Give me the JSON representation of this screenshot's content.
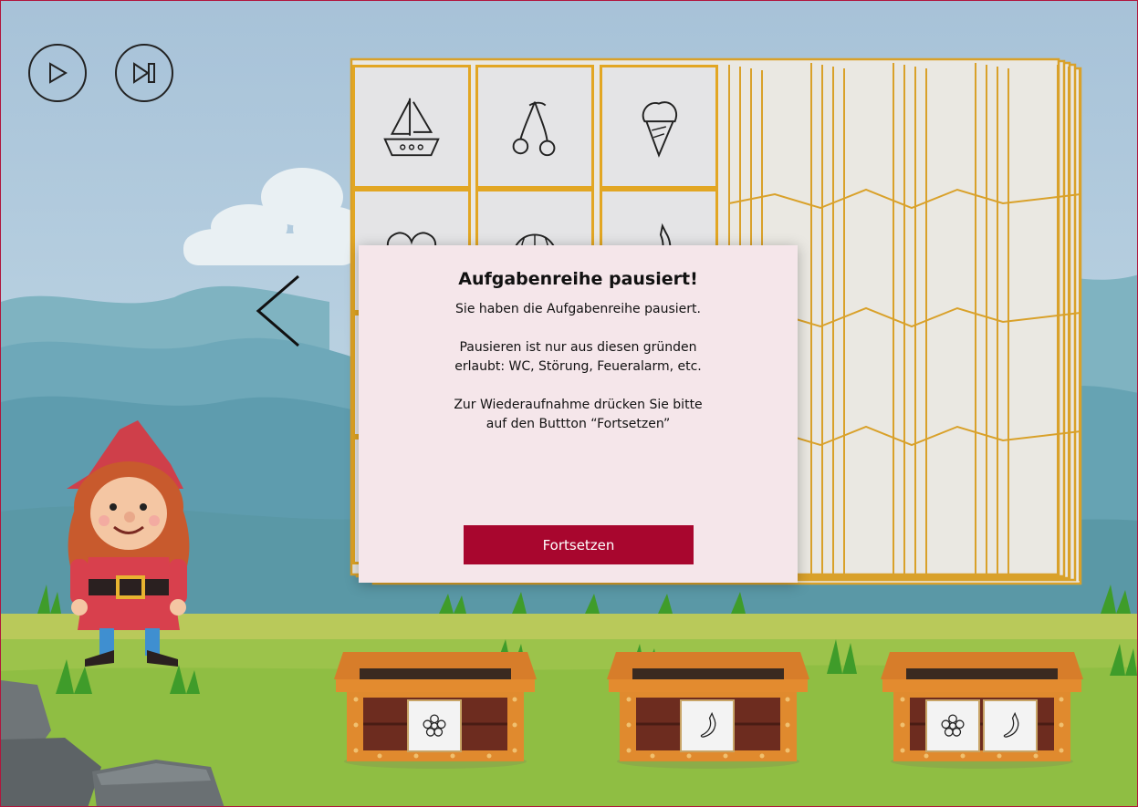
{
  "controls": {
    "play_icon": "play-icon",
    "skip_icon": "skip-forward-icon",
    "prev_icon": "chevron-left-icon"
  },
  "card_grid": {
    "visible_cards": [
      {
        "row": 0,
        "col": 0,
        "icon": "sailboat-icon"
      },
      {
        "row": 0,
        "col": 1,
        "icon": "cherries-icon"
      },
      {
        "row": 0,
        "col": 2,
        "icon": "ice-cream-icon"
      },
      {
        "row": 1,
        "col": 0,
        "icon": "heart-icon"
      },
      {
        "row": 1,
        "col": 1,
        "icon": "melon-icon"
      },
      {
        "row": 1,
        "col": 2,
        "icon": "banana-icon"
      }
    ]
  },
  "modal": {
    "title": "Aufgabenreihe pausiert!",
    "paragraph1": "Sie haben die Aufgabenreihe pausiert.",
    "paragraph2": "Pausieren ist nur aus diesen gründen erlaubt: WC, Störung, Feueralarm, etc.",
    "paragraph3": "Zur Wiederaufnahme drücken Sie bitte auf den Buttton “Fortsetzen”",
    "button_label": "Fortsetzen"
  },
  "chests": [
    {
      "cards": [
        "flower-icon"
      ]
    },
    {
      "cards": [
        "banana-icon"
      ]
    },
    {
      "cards": [
        "flower-icon",
        "banana-icon"
      ]
    }
  ],
  "colors": {
    "accent": "#a8062e",
    "card_border": "#e2a623",
    "modal_bg": "#f5e6ea"
  }
}
